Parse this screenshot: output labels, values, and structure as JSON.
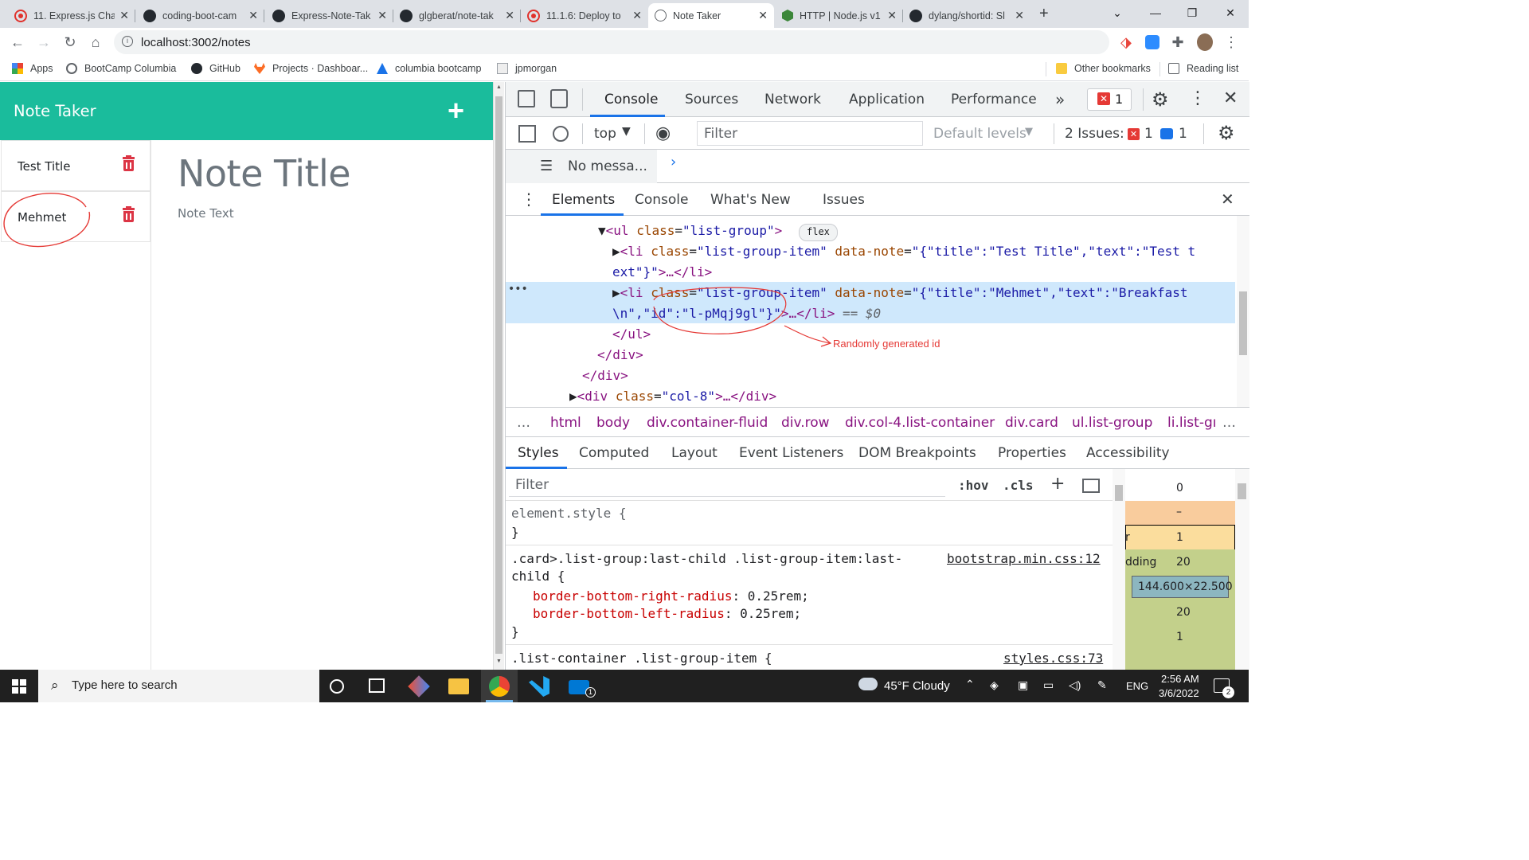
{
  "browser": {
    "tabs": [
      {
        "title": "11. Express.js Cha",
        "icon": "bootcamp-icon"
      },
      {
        "title": "coding-boot-cam",
        "icon": "github-icon"
      },
      {
        "title": "Express-Note-Tak",
        "icon": "github-icon"
      },
      {
        "title": "glgberat/note-tak",
        "icon": "github-icon"
      },
      {
        "title": "11.1.6: Deploy to",
        "icon": "bootcamp-icon"
      },
      {
        "title": "Note Taker",
        "icon": "globe-icon"
      },
      {
        "title": "HTTP | Node.js v1",
        "icon": "nodejs-icon"
      },
      {
        "title": "dylang/shortid: Sl",
        "icon": "github-icon"
      }
    ],
    "url": "localhost:3002/notes",
    "bookmarks": [
      "Apps",
      "BootCamp Columbia",
      "GitHub",
      "Projects · Dashboar...",
      "columbia bootcamp",
      "jpmorgan"
    ],
    "other_bookmarks": "Other bookmarks",
    "reading_list": "Reading list"
  },
  "app": {
    "brand": "Note Taker",
    "add_button": "+",
    "notes": [
      {
        "title": "Test Title"
      },
      {
        "title": "Mehmet"
      }
    ],
    "note_title_placeholder": "Note Title",
    "note_text_placeholder": "Note Text"
  },
  "devtools": {
    "top_tabs": [
      "Console",
      "Sources",
      "Network",
      "Application",
      "Performance"
    ],
    "more": "»",
    "error_count": "1",
    "context": "top",
    "filter_placeholder": "Filter",
    "levels": "Default levels",
    "issues_label": "2 Issues:",
    "issues_errors": "1",
    "issues_info": "1",
    "no_messages": "No messa...",
    "drawer_tabs": [
      "Elements",
      "Console",
      "What's New",
      "Issues"
    ],
    "dom": {
      "ul_tag": "<ul",
      "ul_attr": "class",
      "ul_val": "\"list-group\"",
      "flex_badge": "flex",
      "li1_open": "<li",
      "li1_attr1": "class",
      "li1_val1": "\"list-group-item\"",
      "li1_attr2": "data-note",
      "li1_val2a": "\"{\"title\":\"Test Title\",\"text\":\"Test t",
      "li1_val2b": "ext\"}\"",
      "li_tail": ">…</li>",
      "li2_val2a": "\"{\"title\":\"Mehmet\",\"text\":\"Breakfast",
      "li2_val2b": "\\n\",\"id\":\"l-pMqj9gl\"}\"",
      "li2_tail": ">…</li>",
      "li2_eq": "== $0",
      "ul_close": "</ul>",
      "div_close1": "</div>",
      "div_close2": "</div>",
      "div_col8_open": "<div",
      "div_col8_attr": "class",
      "div_col8_val": "\"col-8\"",
      "div_col8_tail": ">…</div>"
    },
    "annotation": "Randomly generated id",
    "breadcrumbs": [
      "…",
      "html",
      "body",
      "div.container-fluid",
      "div.row",
      "div.col-4.list-container",
      "div.card",
      "ul.list-group",
      "li.list-gı"
    ],
    "style_tabs": [
      "Styles",
      "Computed",
      "Layout",
      "Event Listeners",
      "DOM Breakpoints",
      "Properties",
      "Accessibility"
    ],
    "styles_filter": "Filter",
    "hov": ":hov",
    "cls": ".cls",
    "rules": {
      "r1": "element.style {",
      "r1_close": "}",
      "r2_sel_a": ".card>.list-group:last-child .list-group-item:last-",
      "r2_sel_b": "child {",
      "r2_src": "bootstrap.min.css:12",
      "r2_p1": "border-bottom-right-radius",
      "r2_v1": "0.25rem;",
      "r2_p2": "border-bottom-left-radius",
      "r2_v2": "0.25rem;",
      "r2_close": "}",
      "r3_sel": ".list-container .list-group-item {",
      "r3_src": "styles.css:73"
    },
    "boxmodel": {
      "m": "0",
      "dash": "–",
      "border_label": "r",
      "border": "1",
      "padding_label": "dding",
      "padding": "20",
      "size": "144.600×22.500",
      "padding_b": "20",
      "border_b": "1"
    }
  },
  "taskbar": {
    "search": "Type here to search",
    "weather": "45°F  Cloudy",
    "lang": "ENG",
    "time": "2:56 AM",
    "date": "3/6/2022",
    "notifications": "2"
  }
}
